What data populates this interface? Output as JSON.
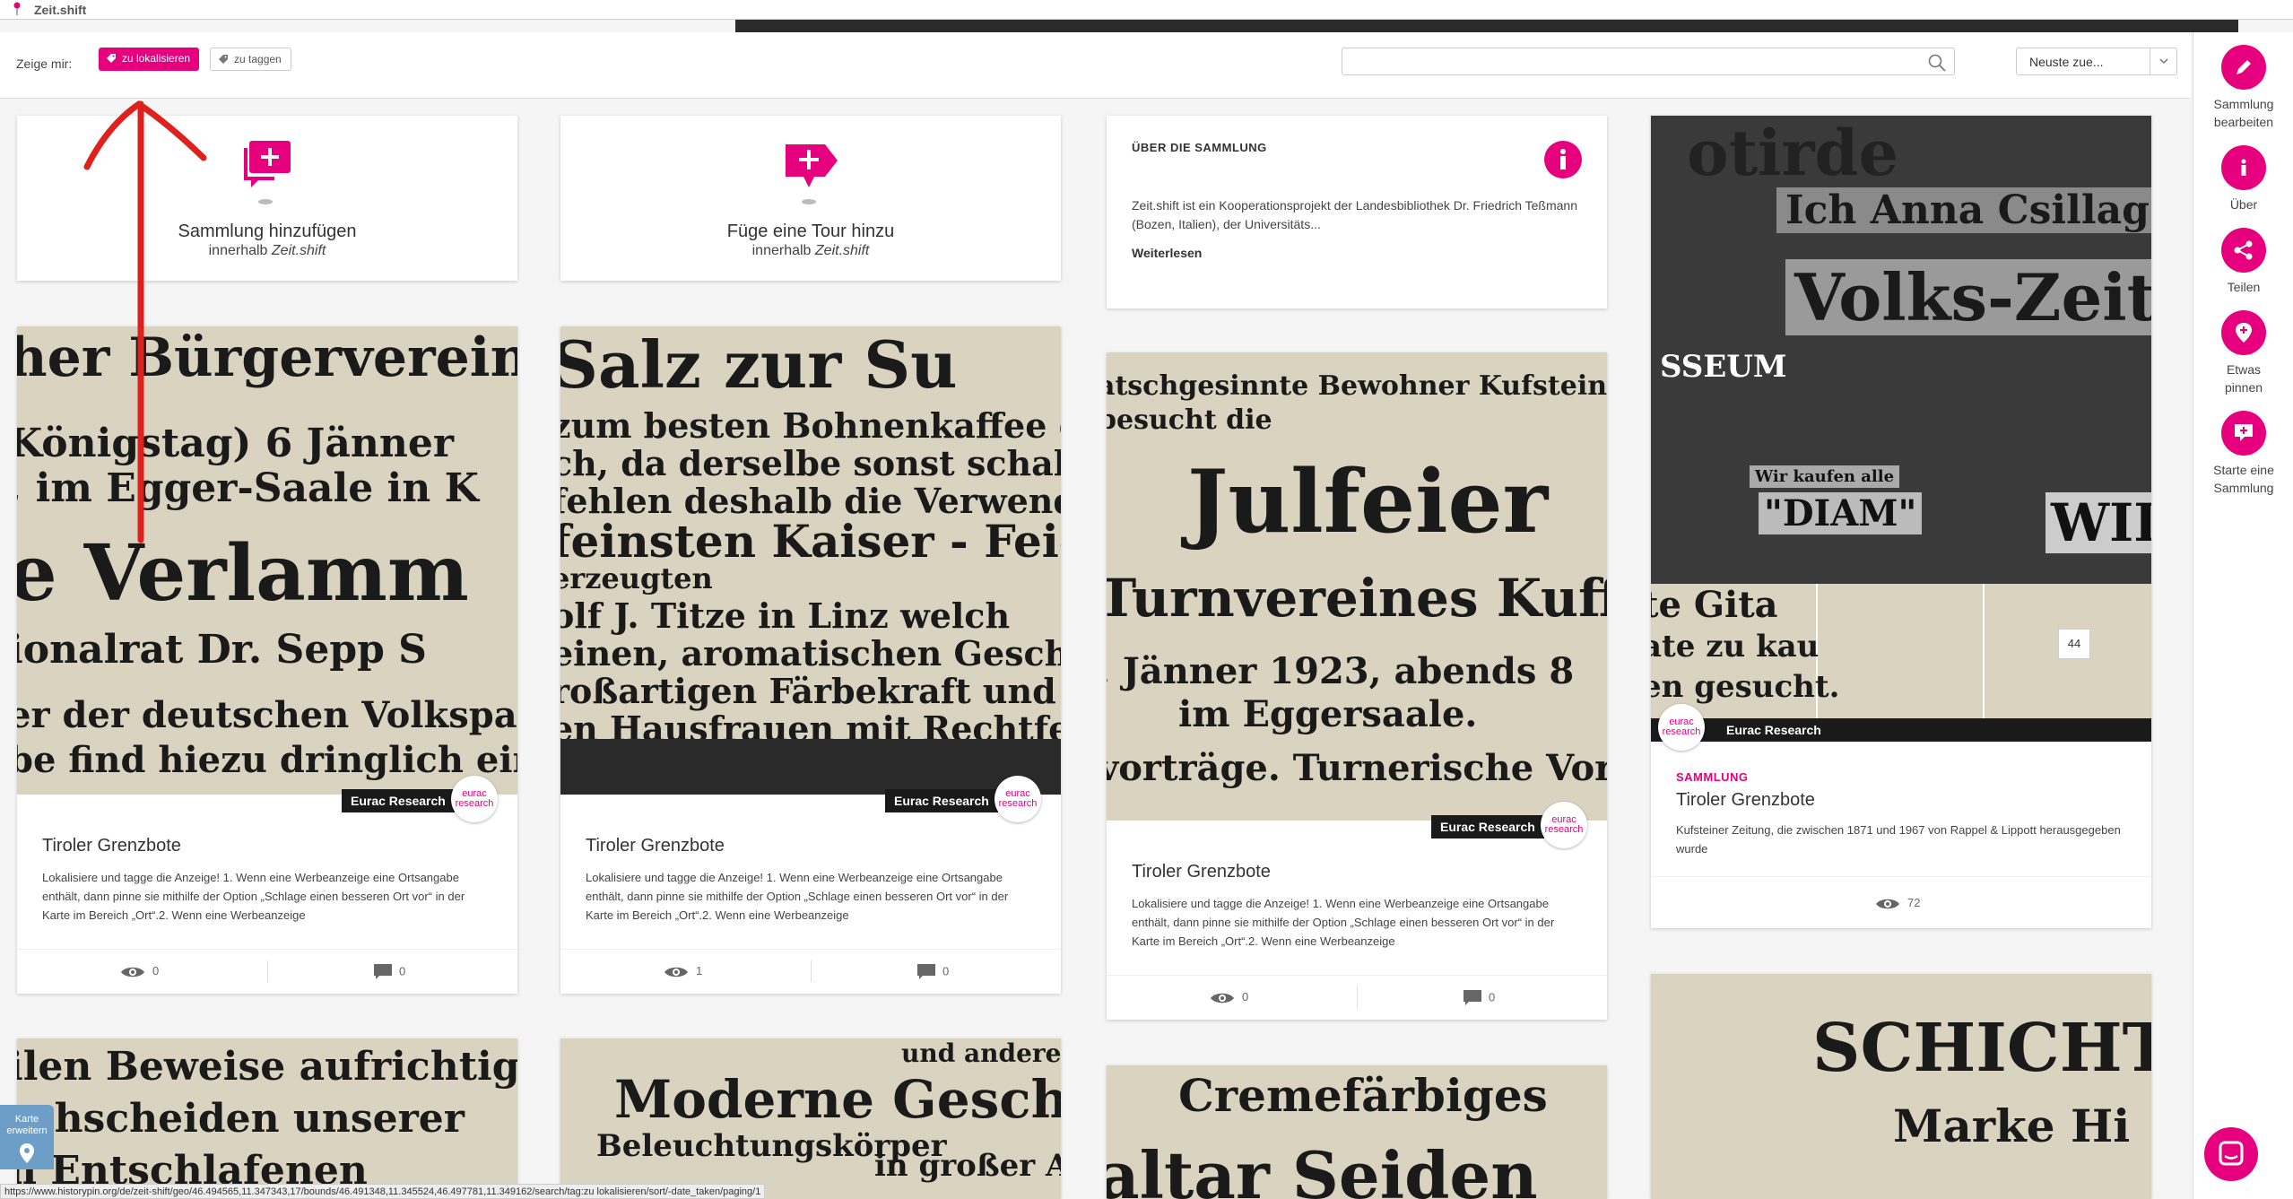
{
  "app": {
    "title": "Zeit.shift"
  },
  "filterbar": {
    "label": "Zeige mir:",
    "chip_localize": "zu lokalisieren",
    "chip_tag": "zu taggen",
    "search_placeholder": "",
    "sort_value": "Neuste zue..."
  },
  "sidebar": {
    "edit": "Sammlung bearbeiten",
    "about": "Über",
    "share": "Teilen",
    "pin": "Etwas pinnen",
    "start": "Starte eine Sammlung"
  },
  "add_collection": {
    "title": "Sammlung hinzufügen",
    "sub_prefix": "innerhalb ",
    "sub_name": "Zeit.shift"
  },
  "add_tour": {
    "title": "Füge eine Tour hinzu",
    "sub_prefix": "innerhalb ",
    "sub_name": "Zeit.shift"
  },
  "about": {
    "heading": "ÜBER DIE SAMMLUNG",
    "text": "Zeit.shift ist ein Kooperationsprojekt der Landesbibliothek Dr. Friedrich Teßmann (Bozen, Italien), der Universitäts...",
    "more": "Weiterlesen"
  },
  "cards": [
    {
      "title": "Tiroler Grenzbote",
      "owner": "Eurac Research",
      "desc": "Lokalisiere und tagge die Anzeige! 1. Wenn eine Werbeanzeige eine Ortsangabe enthält, dann pinne sie mithilfe der Option „Schlage einen besseren Ort vor“ in der Karte im Bereich „Ort“.2. Wenn eine Werbeanzeige",
      "views": "0",
      "comments": "0",
      "image_lines": [
        "her Bürgerverein i",
        "Königstag) 6 Jänner",
        ", im Egger-Saale in K",
        "e Verlamm",
        "ionalrat Dr. Sepp S",
        "er der deutschen Volkspa",
        "be find hiezu dringlich ein"
      ]
    },
    {
      "title": "Tiroler Grenzbote",
      "owner": "Eurac Research",
      "desc": "Lokalisiere und tagge die Anzeige! 1. Wenn eine Werbeanzeige eine Ortsangabe enthält, dann pinne sie mithilfe der Option „Schlage einen besseren Ort vor“ in der Karte im Bereich „Ort“.2. Wenn eine Werbeanzeige",
      "views": "1",
      "comments": "0",
      "image_lines": [
        "Salz zur Su",
        "zum besten Bohnenkaffee ein gu",
        "ch, da derselbe sonst schal und lee",
        "fehlen deshalb die Verwendung de",
        "feinsten  Kaiser - Feigen",
        "erzeugten",
        "olf J. Titze in Linz  welch",
        "einen, aromatischen Geschmack",
        "roßartigen Färbekraft und Ausgieb",
        "en Hausfrauen mit Rechtfets bevor"
      ]
    },
    {
      "title": "Tiroler Grenzbote",
      "owner": "Eurac Research",
      "desc": "Lokalisiere und tagge die Anzeige! 1. Wenn eine Werbeanzeige eine Ortsangabe enthält, dann pinne sie mithilfe der Option „Schlage einen besseren Ort vor“ in der Karte im Bereich „Ort“.2. Wenn eine Werbeanzeige",
      "views": "0",
      "comments": "0",
      "image_lines": [
        "atschgesinnte Bewohner Kufsteins",
        "besucht die",
        "Julfeier",
        "Turnvereines Kuff",
        ". Jänner 1923, abends 8",
        "im Eggersaale.",
        "vorträge. Turnerische Vorführu"
      ]
    }
  ],
  "collection": {
    "label": "SAMMLUNG",
    "title": "Tiroler Grenzbote",
    "owner": "Eurac Research",
    "desc": "Kufsteiner Zeitung, die zwischen 1871 und 1967 von Rappel & Lippott herausgegeben wurde",
    "views": "72",
    "count": "44",
    "image_lines": [
      "otirde",
      "Ich Anna Csillag",
      "Volks-Zeitung",
      "SSEUM",
      "Wir kaufen alle",
      "\"DIAM\"",
      "WIDE"
    ]
  },
  "bottom_cards": [
    {
      "image_lines": [
        "ilen Beweise aufrichtig",
        "schscheiden unserer",
        "n Entschlafenen"
      ]
    },
    {
      "image_lines": [
        "und andere",
        "Moderne  Gesch",
        "Beleuchtungskörper",
        "in großer Auswa"
      ]
    },
    {
      "image_lines": [
        "Cremefärbiges",
        "altar Seiden"
      ]
    },
    {
      "image_lines": [
        "SCHICHT-",
        "Marke Hi"
      ]
    }
  ],
  "map_button": "Karte erweitern",
  "status_url": "https://www.historypin.org/de/zeit-shift/geo/46.494565,11.347343,17/bounds/46.491348,11.345524,46.497781,11.349162/search/tag:zu lokalisieren/sort/-date_taken/paging/1",
  "colors": {
    "accent": "#e6007e",
    "annotation": "#e0201c",
    "map_button": "#6d9ec8"
  }
}
